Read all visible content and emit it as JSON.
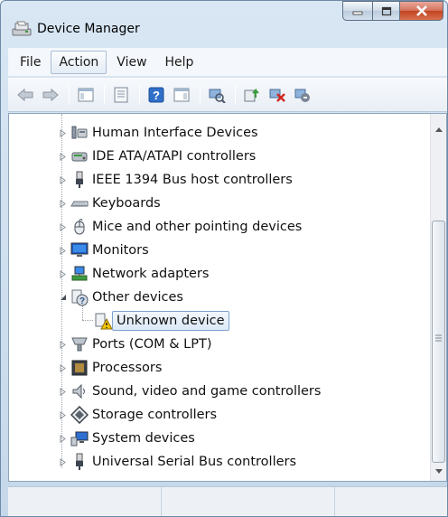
{
  "window": {
    "title": "Device Manager"
  },
  "menu": {
    "items": [
      "File",
      "Action",
      "View",
      "Help"
    ],
    "highlighted": "Action"
  },
  "toolbar": {
    "buttons": [
      "back-icon",
      "forward-icon",
      "show-hide-console-tree-icon",
      "properties-icon",
      "help-icon",
      "action-pane-icon",
      "scan-hardware-icon",
      "update-driver-icon",
      "uninstall-icon",
      "enable-device-icon"
    ]
  },
  "tree": {
    "items": [
      {
        "label": "Human Interface Devices",
        "icon": "hid-icon",
        "expanded": false
      },
      {
        "label": "IDE ATA/ATAPI controllers",
        "icon": "ide-controller-icon",
        "expanded": false
      },
      {
        "label": "IEEE 1394 Bus host controllers",
        "icon": "ieee1394-icon",
        "expanded": false
      },
      {
        "label": "Keyboards",
        "icon": "keyboard-icon",
        "expanded": false
      },
      {
        "label": "Mice and other pointing devices",
        "icon": "mouse-icon",
        "expanded": false
      },
      {
        "label": "Monitors",
        "icon": "monitor-icon",
        "expanded": false
      },
      {
        "label": "Network adapters",
        "icon": "network-adapter-icon",
        "expanded": false
      },
      {
        "label": "Other devices",
        "icon": "other-devices-icon",
        "expanded": true
      },
      {
        "label": "Unknown device",
        "icon": "unknown-device-warning-icon",
        "child": true,
        "selected": true
      },
      {
        "label": "Ports (COM & LPT)",
        "icon": "port-icon",
        "expanded": false
      },
      {
        "label": "Processors",
        "icon": "processor-icon",
        "expanded": false
      },
      {
        "label": "Sound, video and game controllers",
        "icon": "sound-icon",
        "expanded": false
      },
      {
        "label": "Storage controllers",
        "icon": "storage-controller-icon",
        "expanded": false
      },
      {
        "label": "System devices",
        "icon": "system-devices-icon",
        "expanded": false
      },
      {
        "label": "Universal Serial Bus controllers",
        "icon": "usb-icon",
        "expanded": false
      }
    ]
  },
  "colors": {
    "selection_border": "#7da2ce",
    "window_frame": "#c5d8ea",
    "close_button": "#c2441f"
  }
}
